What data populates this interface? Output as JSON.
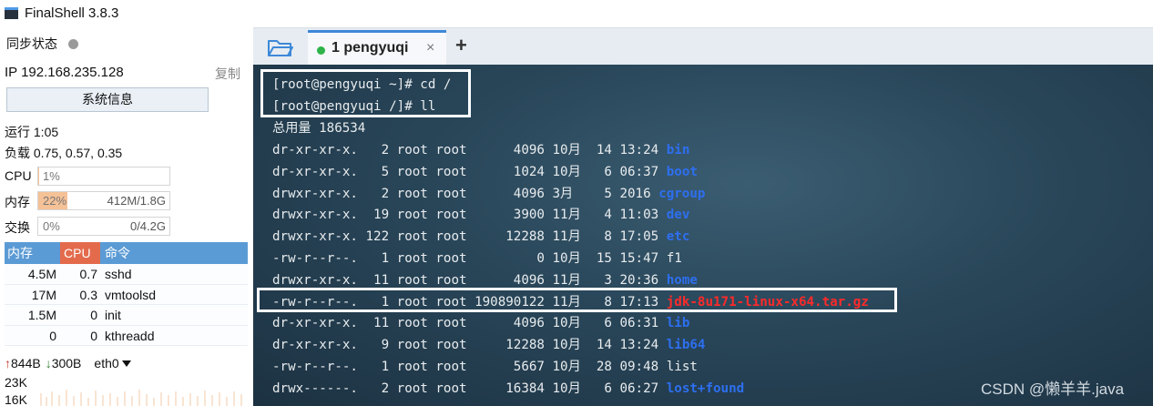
{
  "app": {
    "title": "FinalShell 3.8.3"
  },
  "sidebar": {
    "sync_label": "同步状态",
    "ip_label": "IP 192.168.235.128",
    "copy_label": "复制",
    "sysinfo_button": "系统信息",
    "uptime": "运行 1:05",
    "load": "负载 0.75, 0.57, 0.35",
    "cpu": {
      "label": "CPU",
      "percent": "1%",
      "value": "",
      "fill": 0.01
    },
    "mem": {
      "label": "内存",
      "percent": "22%",
      "value": "412M/1.8G",
      "fill": 0.22
    },
    "swap": {
      "label": "交换",
      "percent": "0%",
      "value": "0/4.2G",
      "fill": 0.0
    },
    "proc_headers": {
      "mem": "内存",
      "cpu": "CPU",
      "cmd": "命令"
    },
    "processes": [
      {
        "mem": "4.5M",
        "cpu": "0.7",
        "cmd": "sshd"
      },
      {
        "mem": "17M",
        "cpu": "0.3",
        "cmd": "vmtoolsd"
      },
      {
        "mem": "1.5M",
        "cpu": "0",
        "cmd": "init"
      },
      {
        "mem": "0",
        "cpu": "0",
        "cmd": "kthreadd"
      }
    ],
    "net": {
      "up": "844B",
      "down": "300B",
      "iface": "eth0"
    },
    "graph_labels": [
      "23K",
      "16K"
    ]
  },
  "tabs": {
    "active_label": "1 pengyuqi",
    "close_symbol": "×",
    "add_symbol": "+"
  },
  "terminal": {
    "prompts": [
      "[root@pengyuqi ~]# cd /",
      "[root@pengyuqi /]# ll"
    ],
    "total": "总用量 186534",
    "entries": [
      {
        "meta": "dr-xr-xr-x.   2 root root      4096 10月  14 13:24 ",
        "name": "bin",
        "kind": "dir"
      },
      {
        "meta": "dr-xr-xr-x.   5 root root      1024 10月   6 06:37 ",
        "name": "boot",
        "kind": "dir"
      },
      {
        "meta": "drwxr-xr-x.   2 root root      4096 3月    5 2016 ",
        "name": "cgroup",
        "kind": "dir"
      },
      {
        "meta": "drwxr-xr-x.  19 root root      3900 11月   4 11:03 ",
        "name": "dev",
        "kind": "dir"
      },
      {
        "meta": "drwxr-xr-x. 122 root root     12288 11月   8 17:05 ",
        "name": "etc",
        "kind": "dir"
      },
      {
        "meta": "-rw-r--r--.   1 root root         0 10月  15 15:47 ",
        "name": "f1",
        "kind": "file"
      },
      {
        "meta": "drwxr-xr-x.  11 root root      4096 11月   3 20:36 ",
        "name": "home",
        "kind": "dir"
      },
      {
        "meta": "-rw-r--r--.   1 root root 190890122 11月   8 17:13 ",
        "name": "jdk-8u171-linux-x64.tar.gz",
        "kind": "tgz"
      },
      {
        "meta": "dr-xr-xr-x.  11 root root      4096 10月   6 06:31 ",
        "name": "lib",
        "kind": "dir"
      },
      {
        "meta": "dr-xr-xr-x.   9 root root     12288 10月  14 13:24 ",
        "name": "lib64",
        "kind": "dir"
      },
      {
        "meta": "-rw-r--r--.   1 root root      5667 10月  28 09:48 ",
        "name": "list",
        "kind": "file"
      },
      {
        "meta": "drwx------.   2 root root     16384 10月   6 06:27 ",
        "name": "lost+found",
        "kind": "dir"
      }
    ]
  },
  "watermark": "CSDN @懒羊羊.java",
  "colors": {
    "accent": "#3d88d8",
    "dir": "#2d6ff0",
    "archive": "#ff2a2a",
    "proc_header": "#5b9bd5",
    "cpu_header": "#e36b4c"
  }
}
